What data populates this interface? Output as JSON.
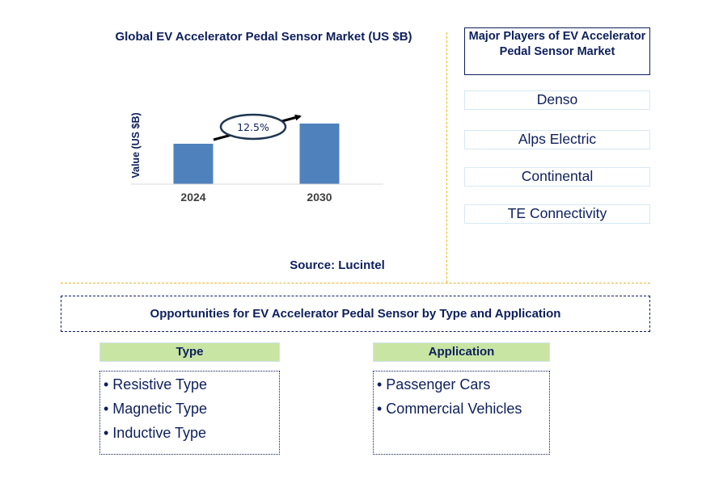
{
  "chart_data": {
    "type": "bar",
    "title": "Global EV Accelerator Pedal Sensor Market (US $B)",
    "xlabel": "",
    "ylabel": "Value (US $B)",
    "categories": [
      "2024",
      "2030"
    ],
    "values": [
      1.0,
      1.5
    ],
    "value_note": "relative bar heights only; no numeric axis shown",
    "ylim": [
      0,
      1.6
    ],
    "grid": false,
    "annotation": {
      "label": "12.5%",
      "meaning": "CAGR growth arrow from 2024 to 2030"
    },
    "colors": {
      "bar": "#4f81bd",
      "text": "#0d1f5c",
      "tick": "#404040"
    }
  },
  "source": "Source: Lucintel",
  "players": {
    "header": "Major Players of EV Accelerator Pedal Sensor Market",
    "items": [
      "Denso",
      "Alps Electric",
      "Continental",
      "TE Connectivity"
    ]
  },
  "opportunities": {
    "title": "Opportunities for EV Accelerator Pedal Sensor by Type and Application",
    "type": {
      "header": "Type",
      "items": [
        "• Resistive Type",
        "• Magnetic Type",
        "• Inductive Type"
      ]
    },
    "application": {
      "header": "Application",
      "items": [
        "• Passenger Cars",
        "• Commercial Vehicles"
      ]
    }
  },
  "colors": {
    "navy": "#0d1f5c",
    "divider": "#f0b428",
    "header_green": "#c9e5a3",
    "player_border": "#d6e8f4"
  }
}
